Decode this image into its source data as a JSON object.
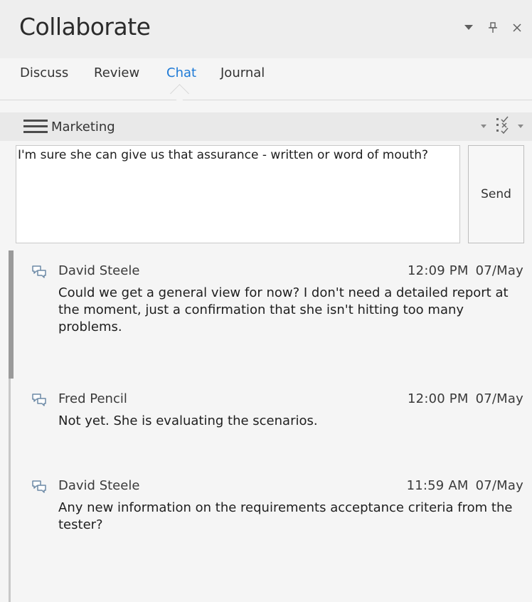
{
  "window": {
    "title": "Collaborate",
    "controls": {
      "dropdown_glyph": "▾",
      "pin_glyph": "⍑",
      "close_glyph": "✕"
    }
  },
  "tabs": [
    {
      "label": "Discuss",
      "active": false
    },
    {
      "label": "Review",
      "active": false
    },
    {
      "label": "Chat",
      "active": true
    },
    {
      "label": "Journal",
      "active": false
    }
  ],
  "channel": {
    "name": "Marketing",
    "icon": "hamburger-menu-icon",
    "filter_icon": "checklist-filter-icon"
  },
  "composer": {
    "text": "I'm sure she can give us that assurance - written or word of mouth?",
    "send_label": "Send"
  },
  "messages": [
    {
      "author": "David Steele",
      "time": "12:09 PM",
      "date": "07/May",
      "text": "Could we get a general view for now? I don't need a detailed report at the moment, just a confirmation that she isn't hitting too many problems.",
      "icon": "chat-bubbles-icon"
    },
    {
      "author": "Fred Pencil",
      "time": "12:00 PM",
      "date": "07/May",
      "text": "Not yet. She is evaluating the scenarios.",
      "icon": "chat-bubbles-icon"
    },
    {
      "author": "David Steele",
      "time": "11:59 AM",
      "date": "07/May",
      "text": "Any new information on the requirements acceptance criteria from the tester?",
      "icon": "chat-bubbles-icon"
    }
  ],
  "colors": {
    "accent": "#1e7ad6",
    "panel_bg": "#f5f5f5",
    "title_bg": "#eeeeee",
    "channel_bg": "#e9e9e9"
  }
}
